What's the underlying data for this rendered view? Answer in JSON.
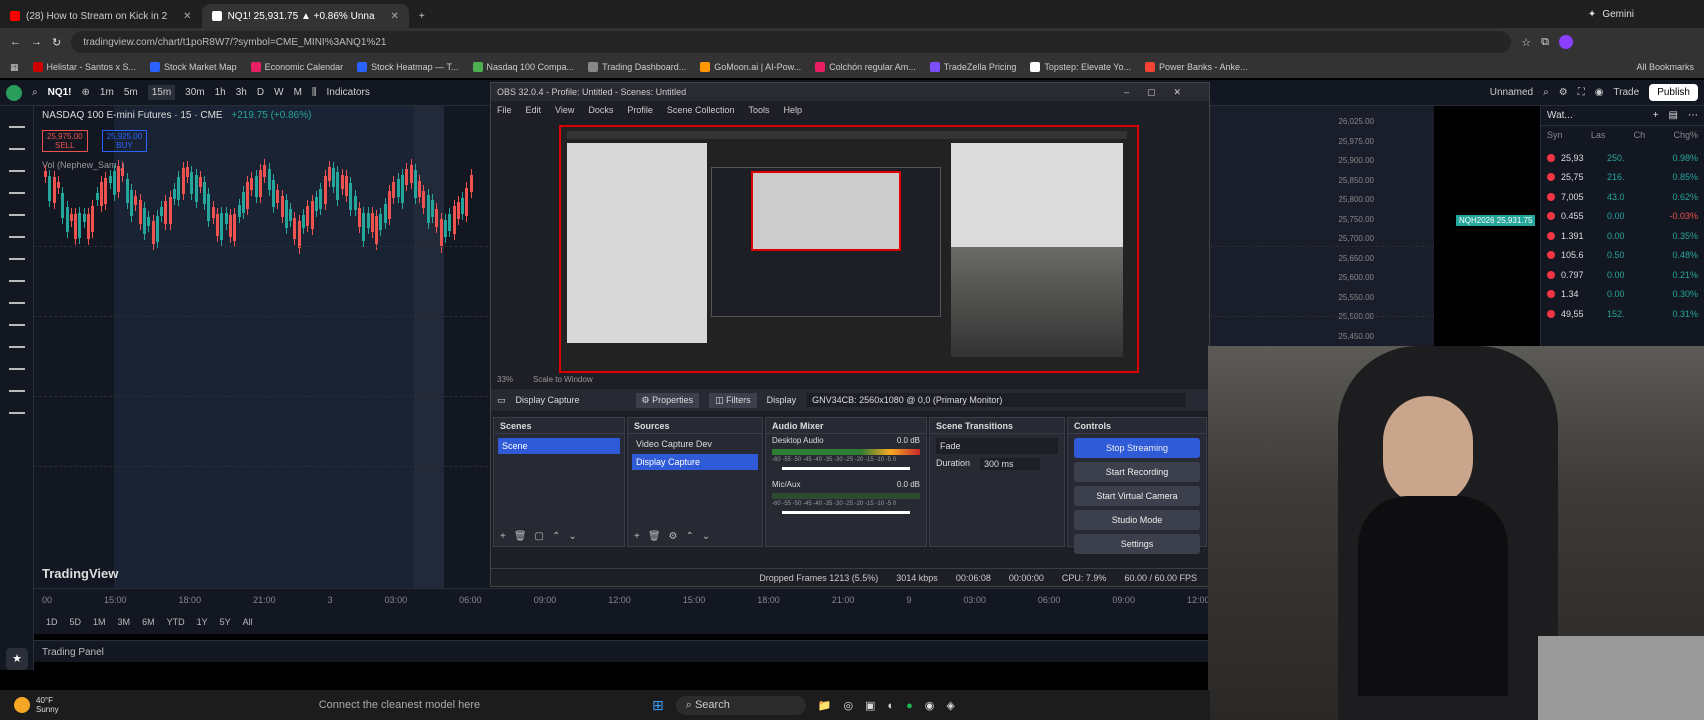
{
  "browser": {
    "tabs": [
      {
        "label": "(28) How to Stream on Kick in 2",
        "active": false
      },
      {
        "label": "NQ1! 25,931.75 ▲ +0.86% Unna",
        "active": true
      }
    ],
    "url": "tradingview.com/chart/t1poR8W7/?symbol=CME_MINI%3ANQ1%21",
    "gemini_label": "Gemini",
    "bookmarks": [
      "Helistar - Santos x S...",
      "Stock Market Map",
      "Economic Calendar",
      "Stock Heatmap — T...",
      "Nasdaq 100 Compa...",
      "Trading Dashboard...",
      "GoMoon.ai | AI-Pow...",
      "Colchón regular Am...",
      "TradeZella Pricing",
      "Topstep: Elevate Yo...",
      "Power Banks - Anke..."
    ],
    "all_bookmarks": "All Bookmarks"
  },
  "tradingview": {
    "symbol": "NQ1!",
    "intervals": [
      "1m",
      "5m",
      "15m",
      "30m",
      "1h",
      "3h",
      "D",
      "W",
      "M"
    ],
    "indicators_label": "Indicators",
    "unnamed_label": "Unnamed",
    "trade_label": "Trade",
    "publish_label": "Publish",
    "instrument_title": "NASDAQ 100 E-mini Futures · 15 · CME",
    "change": "+219.75 (+0.86%)",
    "sell_price": "25,975.00",
    "sell_label": "SELL",
    "buy_price": "25,925.00",
    "buy_label": "BUY",
    "vol_label": "Vol (Nephew_Sam_)",
    "logo_text": "TradingView",
    "time_ticks": [
      "00",
      "15:00",
      "18:00",
      "21:00",
      "3",
      "03:00",
      "06:00",
      "09:00",
      "12:00",
      "15:00",
      "18:00",
      "21:00",
      "9",
      "03:00",
      "06:00",
      "09:00",
      "12:00",
      "15:00",
      "18:00",
      "21:00",
      "12",
      "03"
    ],
    "ranges": [
      "1D",
      "5D",
      "1M",
      "3M",
      "6M",
      "YTD",
      "1Y",
      "5Y",
      "All"
    ],
    "trading_panel": "Trading Panel",
    "price_labels": [
      "26,025.00",
      "25,975.00",
      "25,900.00",
      "25,850.00",
      "25,800.00",
      "25,750.00",
      "25,700.00",
      "25,650.00",
      "25,600.00",
      "25,550.00",
      "25,500.00",
      "25,450.00",
      "25,400.00",
      "25,350.00",
      "25,300.00"
    ],
    "nq_tag": "NQH2026 25,931.75",
    "watchlist_title": "Wat...",
    "watchlist_headers": [
      "Syn",
      "Las",
      "Ch",
      "Chg%"
    ],
    "watchlist": [
      {
        "sym": "25,93",
        "last": "250.",
        "chg": "0.98%",
        "color": "#f23645"
      },
      {
        "sym": "25,75",
        "last": "216.",
        "chg": "0.85%",
        "color": "#f23645"
      },
      {
        "sym": "7,005",
        "last": "43.0",
        "chg": "0.62%",
        "color": "#f23645"
      },
      {
        "sym": "0.455",
        "last": "0.00",
        "chg": "-0.03%",
        "color": "#f23645"
      },
      {
        "sym": "1.391",
        "last": "0.00",
        "chg": "0.35%",
        "color": "#f23645"
      },
      {
        "sym": "105.6",
        "last": "0.50",
        "chg": "0.48%",
        "color": "#f23645"
      },
      {
        "sym": "0.797",
        "last": "0.00",
        "chg": "0.21%",
        "color": "#f23645"
      },
      {
        "sym": "1.34",
        "last": "0.00",
        "chg": "0.30%",
        "color": "#f23645"
      },
      {
        "sym": "49,55",
        "last": "152.",
        "chg": "0.31%",
        "color": "#f23645"
      }
    ]
  },
  "obs": {
    "title": "OBS 32.0.4 - Profile: Untitled - Scenes: Untitled",
    "menu": [
      "File",
      "Edit",
      "View",
      "Docks",
      "Profile",
      "Scene Collection",
      "Tools",
      "Help"
    ],
    "zoom": "33%",
    "scale": "Scale to Window",
    "source_name": "Display Capture",
    "properties": "Properties",
    "filters": "Filters",
    "display_label": "Display",
    "display_value": "GNV34CB: 2560x1080 @ 0,0 (Primary Monitor)",
    "scenes_title": "Scenes",
    "scene_item": "Scene",
    "sources_title": "Sources",
    "sources": [
      "Video Capture Dev",
      "Display Capture"
    ],
    "mixer_title": "Audio Mixer",
    "mixer": [
      {
        "name": "Desktop Audio",
        "db": "0.0 dB"
      },
      {
        "name": "Mic/Aux",
        "db": "0.0 dB"
      }
    ],
    "mixer_scale": "-60 -55 -50 -45 -40 -35 -30 -25 -20 -15 -10 -5 0",
    "transitions_title": "Scene Transitions",
    "transition": "Fade",
    "duration_label": "Duration",
    "duration": "300 ms",
    "controls_title": "Controls",
    "controls": [
      "Stop Streaming",
      "Start Recording",
      "Start Virtual Camera",
      "Studio Mode",
      "Settings"
    ],
    "status": {
      "dropped": "Dropped Frames 1213 (5.5%)",
      "kbps": "3014 kbps",
      "stream_time": "00:06:08",
      "rec_time": "00:00:00",
      "cpu": "CPU: 7.9%",
      "fps": "60.00 / 60.00 FPS"
    }
  },
  "taskbar": {
    "weather_temp": "40°F",
    "weather_desc": "Sunny",
    "search": "Search",
    "caption": "Connect the cleanest model here"
  },
  "colors": {
    "accent_blue": "#2f5bd8",
    "tv_bg": "#131722",
    "up": "#26a69a",
    "down": "#ef5350"
  }
}
